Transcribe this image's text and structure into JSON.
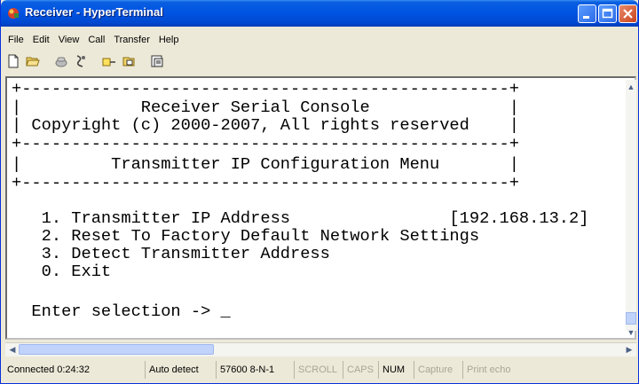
{
  "window": {
    "title": "Receiver - HyperTerminal"
  },
  "menu": {
    "items": [
      "File",
      "Edit",
      "View",
      "Call",
      "Transfer",
      "Help"
    ]
  },
  "toolbar": {
    "icons": [
      "new-document-icon",
      "open-folder-icon",
      "connect-phone-icon",
      "disconnect-icon",
      "send-icon",
      "receive-icon",
      "properties-icon"
    ]
  },
  "terminal": {
    "lines": [
      "+-------------------------------------------------+",
      "|            Receiver Serial Console              |",
      "| Copyright (c) 2000-2007, All rights reserved    |",
      "+-------------------------------------------------+",
      "|         Transmitter IP Configuration Menu       |",
      "+-------------------------------------------------+",
      "",
      "   1. Transmitter IP Address                [192.168.13.2]",
      "   2. Reset To Factory Default Network Settings",
      "   3. Detect Transmitter Address",
      "   0. Exit",
      "",
      "  Enter selection -> _"
    ]
  },
  "status": {
    "connected": "Connected 0:24:32",
    "detect": "Auto detect",
    "baud": "57600 8-N-1",
    "scroll": "SCROLL",
    "caps": "CAPS",
    "num": "NUM",
    "capture": "Capture",
    "print_echo": "Print echo"
  }
}
